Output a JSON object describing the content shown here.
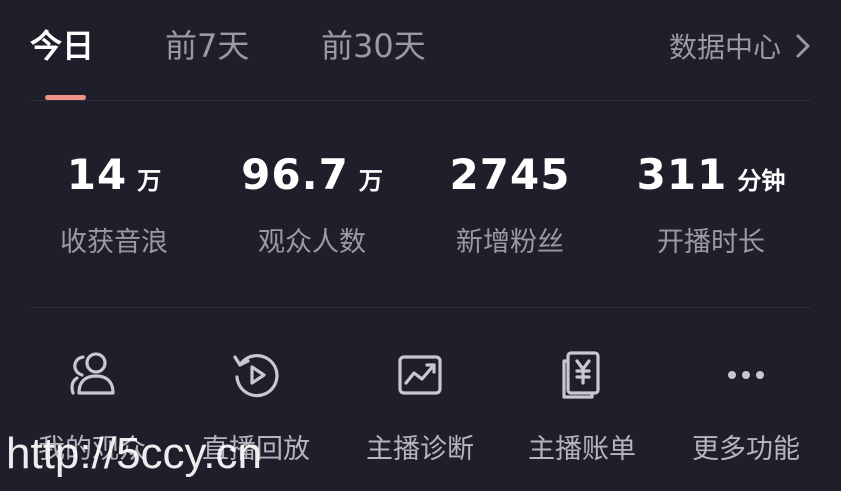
{
  "tabs": [
    {
      "label": "今日",
      "active": true
    },
    {
      "label": "前7天",
      "active": false
    },
    {
      "label": "前30天",
      "active": false
    }
  ],
  "data_center": {
    "label": "数据中心",
    "icon": "chevron-right-icon"
  },
  "stats": [
    {
      "value": "14",
      "unit": "万",
      "label": "收获音浪"
    },
    {
      "value": "96.7",
      "unit": "万",
      "label": "观众人数"
    },
    {
      "value": "2745",
      "unit": "",
      "label": "新增粉丝"
    },
    {
      "value": "311",
      "unit": "分钟",
      "label": "开播时长"
    }
  ],
  "features": [
    {
      "label": "我的观众",
      "icon": "audience-icon"
    },
    {
      "label": "直播回放",
      "icon": "replay-icon"
    },
    {
      "label": "主播诊断",
      "icon": "diagnosis-icon"
    },
    {
      "label": "主播账单",
      "icon": "bill-icon"
    },
    {
      "label": "更多功能",
      "icon": "more-icon"
    }
  ],
  "watermark": "http://5ccy.cn",
  "colors": {
    "background": "#1f1f2b",
    "accent": "#f0938a",
    "text_primary": "#ffffff",
    "text_secondary": "#9a9aa6"
  }
}
